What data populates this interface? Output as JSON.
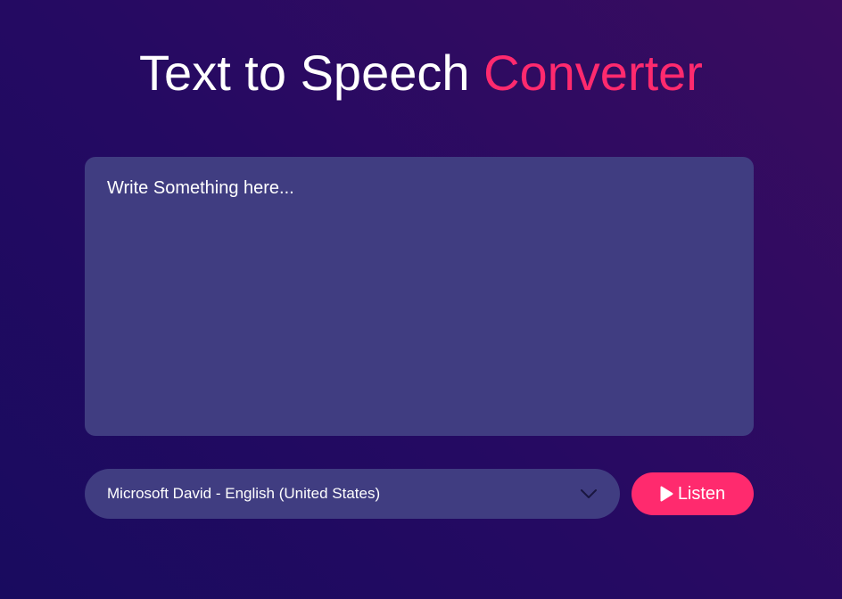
{
  "title": {
    "main": "Text to Speech",
    "accent": "Converter"
  },
  "textarea": {
    "placeholder": "Write Something here...",
    "value": ""
  },
  "voice_select": {
    "selected": "Microsoft David - English (United States)",
    "icon": "chevron-down-icon"
  },
  "listen_button": {
    "label": "Listen",
    "icon": "play-icon"
  },
  "colors": {
    "accent": "#ff2a6e",
    "panel": "#403d81",
    "background_start": "#190b5f",
    "background_end": "#3a0c60"
  }
}
